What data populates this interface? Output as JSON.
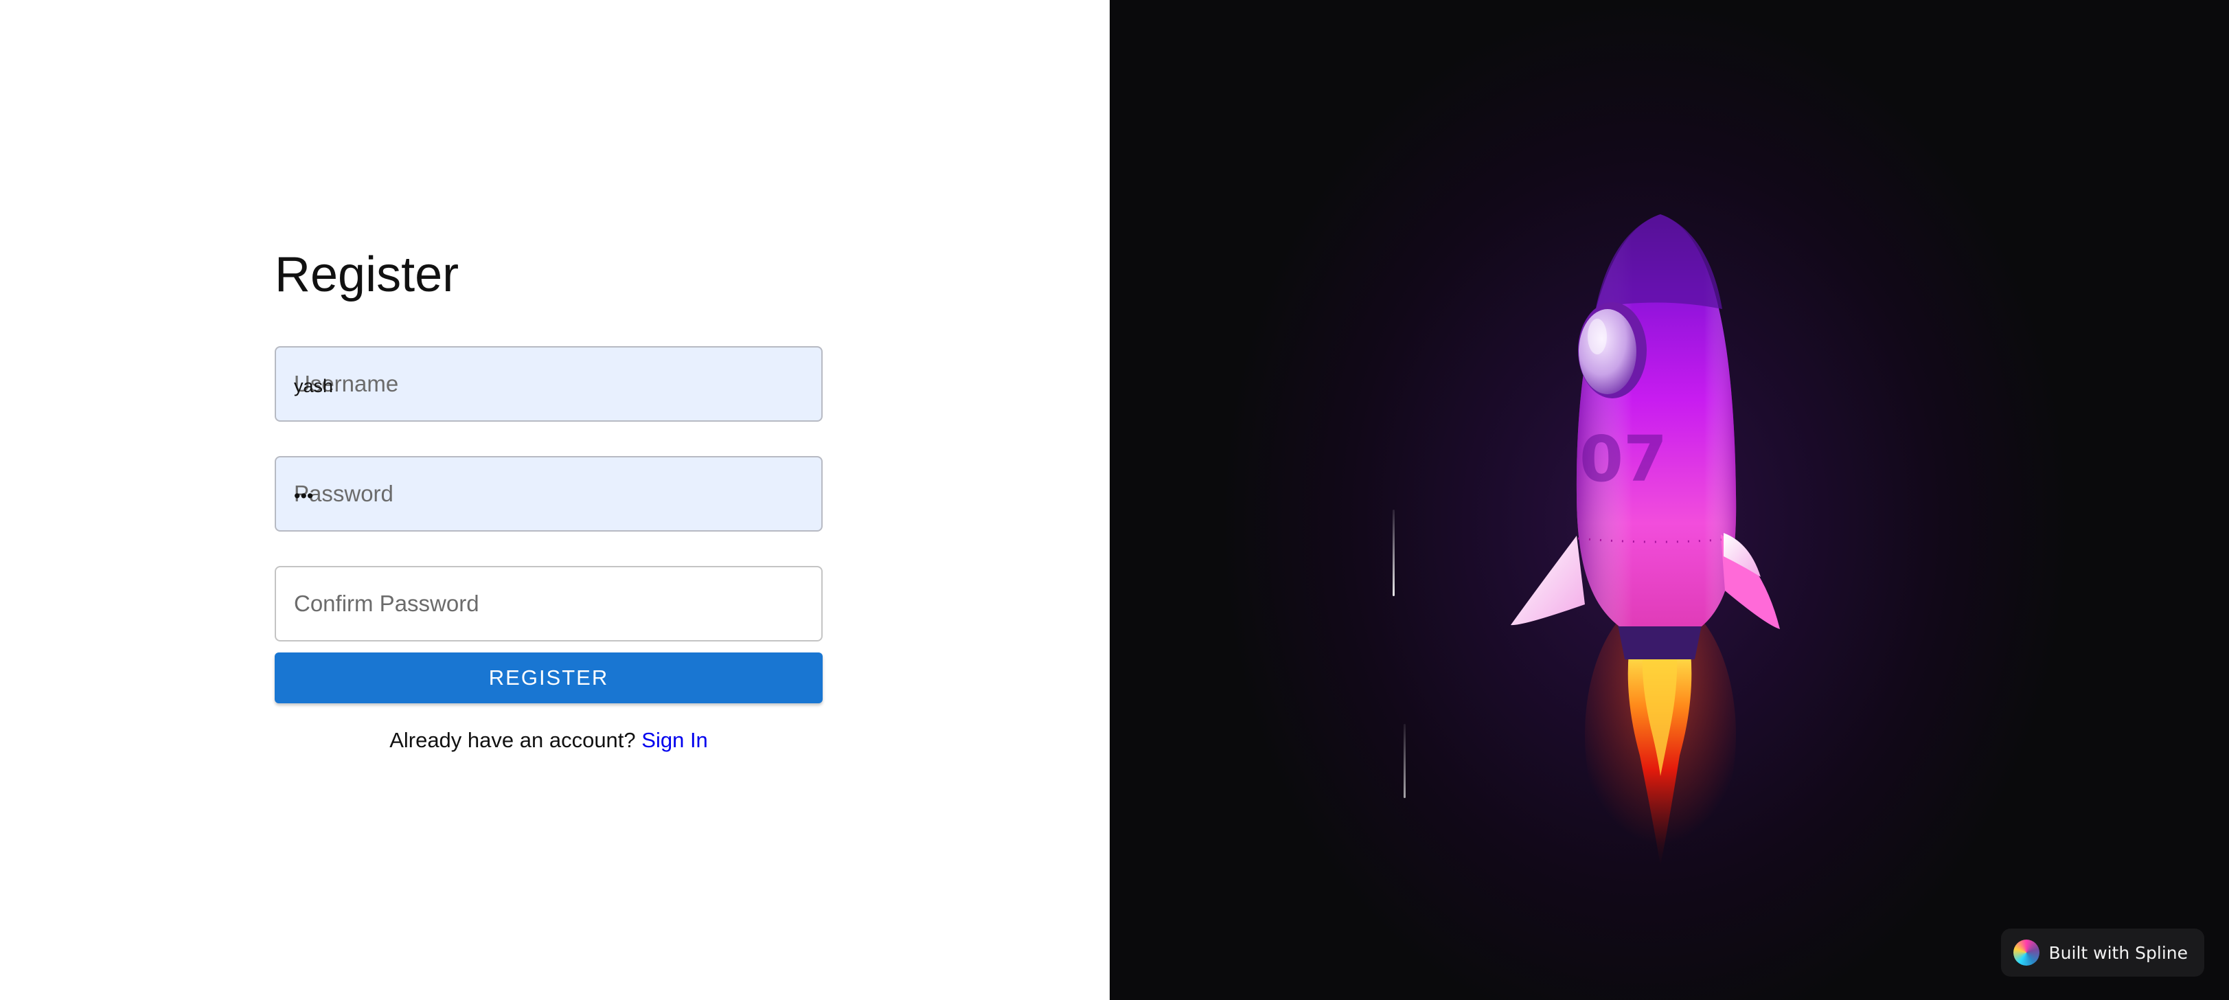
{
  "form": {
    "title": "Register",
    "username": {
      "placeholder": "Username",
      "value": "yash"
    },
    "password": {
      "placeholder": "Password",
      "value": "•••"
    },
    "confirm_password": {
      "placeholder": "Confirm Password",
      "value": ""
    },
    "register_label": "REGISTER",
    "signin_prompt": "Already have an account?",
    "signin_link": "Sign In"
  },
  "scene": {
    "rocket_number": "07",
    "badge_text": "Built with Spline"
  },
  "colors": {
    "primary": "#1976d2",
    "link": "#0000ee",
    "autofill_bg": "#e8f0fe",
    "scene_bg": "#0a0a0c",
    "rocket_body": "#c81cf0"
  }
}
